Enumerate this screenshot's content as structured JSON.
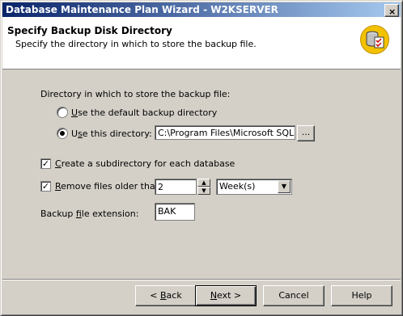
{
  "window": {
    "title": "Database Maintenance Plan Wizard - W2KSERVER",
    "close_glyph": "×"
  },
  "header": {
    "title": "Specify Backup Disk Directory",
    "subtitle": "Specify the directory in which to store the backup file.",
    "icon": "database-checklist-icon"
  },
  "directory_group": {
    "label": "Directory in which to store the backup file:",
    "option_default": {
      "accel": "U",
      "rest": "se the default backup directory",
      "selected": false
    },
    "option_custom": {
      "accel": "s",
      "pre": "U",
      "rest": "e this directory:",
      "selected": true
    },
    "path_value": "C:\\Program Files\\Microsoft SQL Se",
    "browse_label": "..."
  },
  "subdirectory": {
    "accel": "C",
    "rest": "reate a subdirectory for each database",
    "checked": true
  },
  "remove_files": {
    "accel": "R",
    "rest": "emove files older than:",
    "checked": true,
    "amount": "2",
    "unit": "Week(s)"
  },
  "extension": {
    "pre": "Backup ",
    "accel": "f",
    "rest": "ile extension:",
    "value": "BAK"
  },
  "footer": {
    "back": {
      "pre": "< ",
      "accel": "B",
      "rest": "ack"
    },
    "next": {
      "accel": "N",
      "rest": "ext >"
    },
    "cancel": "Cancel",
    "help": "Help"
  }
}
